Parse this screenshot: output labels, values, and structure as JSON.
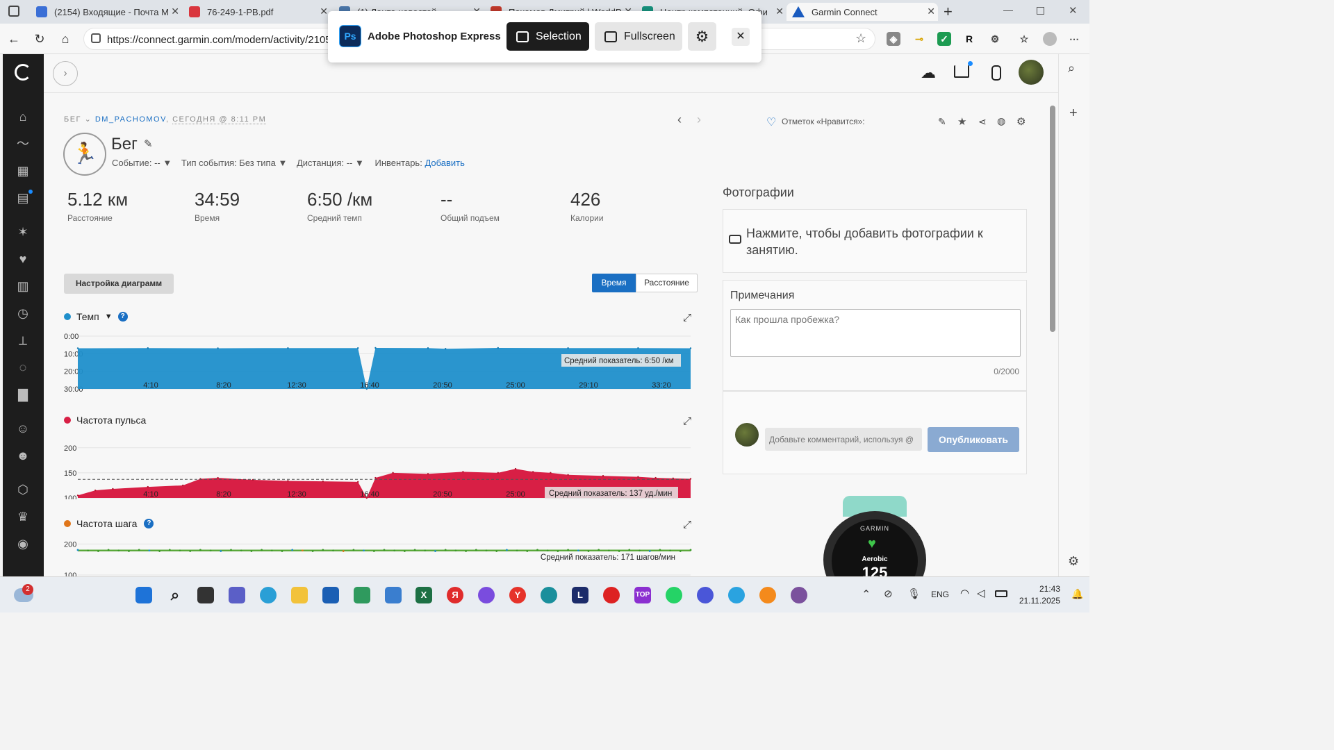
{
  "browser": {
    "tabs": [
      {
        "title": "(2154) Входящие - Почта М",
        "color": "#3b6fd6"
      },
      {
        "title": "76-249-1-PB.pdf",
        "color": "#d9363e"
      },
      {
        "title": "(1) Лента новостей",
        "color": "#4a76a8"
      },
      {
        "title": "Пахомов Дмитрий | WorldP",
        "color": "#c0392b"
      },
      {
        "title": "Центр компетенций -Офи",
        "color": "#16907c"
      },
      {
        "title": "Garmin Connect",
        "color": "#1a5bbf"
      }
    ],
    "url": "https://connect.garmin.com/modern/activity/2105"
  },
  "photoshop": {
    "app_name": "Adobe Photoshop Express",
    "logo_text": "Ps",
    "selection_label": "Selection",
    "fullscreen_label": "Fullscreen"
  },
  "activity": {
    "breadcrumb_type": "БЕГ",
    "breadcrumb_user": "DM_PACHOMOV",
    "breadcrumb_sep": ",",
    "breadcrumb_time": "СЕГОДНЯ @ 8:11 PM",
    "title": "Бег",
    "event_label": "Событие: --",
    "event_type_label": "Тип события: Без типа",
    "distance_label": "Дистанция: --",
    "gear_label": "Инвентарь:",
    "gear_link": "Добавить",
    "likes_label": "Отметок «Нравится»:"
  },
  "stats": [
    {
      "value": "5.12 км",
      "label": "Расстояние"
    },
    {
      "value": "34:59",
      "label": "Время"
    },
    {
      "value": "6:50 /км",
      "label": "Средний темп"
    },
    {
      "value": "--",
      "label": "Общий подъем"
    },
    {
      "value": "426",
      "label": "Калории"
    }
  ],
  "controls": {
    "chart_settings": "Настройка диаграмм",
    "toggle_time": "Время",
    "toggle_distance": "Расстояние"
  },
  "photos": {
    "title": "Фотографии",
    "prompt": "Нажмите, чтобы добавить фотографии к занятию."
  },
  "notes": {
    "title": "Примечания",
    "placeholder": "Как прошла пробежка?",
    "counter": "0/2000"
  },
  "comments": {
    "placeholder": "Добавьте комментарий, используя @",
    "publish": "Опубликовать"
  },
  "watch": {
    "brand": "GARMIN",
    "mode": "Aerobic",
    "value": "125"
  },
  "taskbar": {
    "lang": "ENG",
    "time": "21:43",
    "date": "21.11.2025",
    "weather_badge": "2"
  },
  "colors": {
    "pace": "#1f8fcb",
    "hr": "#d81f45",
    "cadence": "#e0761a",
    "link": "#1a6fc3",
    "nav": "#1d1d1d"
  },
  "chart_data": [
    {
      "type": "area",
      "title": "Темп",
      "x_ticks": [
        "4:10",
        "8:20",
        "12:30",
        "16:40",
        "20:50",
        "25:00",
        "29:10",
        "33:20"
      ],
      "y_ticks": [
        "0:00",
        "10:00",
        "20:00",
        "30:00"
      ],
      "ylim": [
        "0:00",
        "30:00"
      ],
      "y_inverted": true,
      "x": [
        0,
        4,
        8,
        12,
        16,
        16.5,
        17,
        20,
        21,
        24,
        28,
        32,
        35
      ],
      "y": [
        6.9,
        6.8,
        6.9,
        6.8,
        6.8,
        30,
        6.7,
        6.8,
        7.2,
        6.7,
        6.8,
        6.8,
        6.9
      ],
      "annotation": "Средний показатель: 6:50 /км"
    },
    {
      "type": "area",
      "title": "Частота пульса",
      "x_ticks": [
        "4:10",
        "8:20",
        "12:30",
        "16:40",
        "20:50",
        "25:00",
        "29:10",
        "33:20"
      ],
      "y_ticks": [
        "200",
        "150",
        "100"
      ],
      "ylim": [
        100,
        200
      ],
      "x": [
        0,
        1,
        2,
        4,
        6,
        7,
        8,
        10,
        12,
        14,
        16,
        16.5,
        17,
        18,
        20,
        22,
        24,
        25,
        26,
        27,
        28,
        30,
        32,
        33,
        34,
        35
      ],
      "y": [
        105,
        115,
        118,
        122,
        125,
        138,
        140,
        136,
        134,
        133,
        132,
        100,
        140,
        150,
        148,
        152,
        150,
        158,
        152,
        150,
        146,
        144,
        142,
        140,
        139,
        138
      ],
      "average": 137,
      "annotation": "Средний показатель: 137 уд./мин"
    },
    {
      "type": "scatter",
      "title": "Частота шага",
      "y_ticks": [
        "200",
        "100"
      ],
      "ylim": [
        100,
        200
      ],
      "average": 171,
      "annotation": "Средний показатель: 171 шагов/мин"
    }
  ]
}
